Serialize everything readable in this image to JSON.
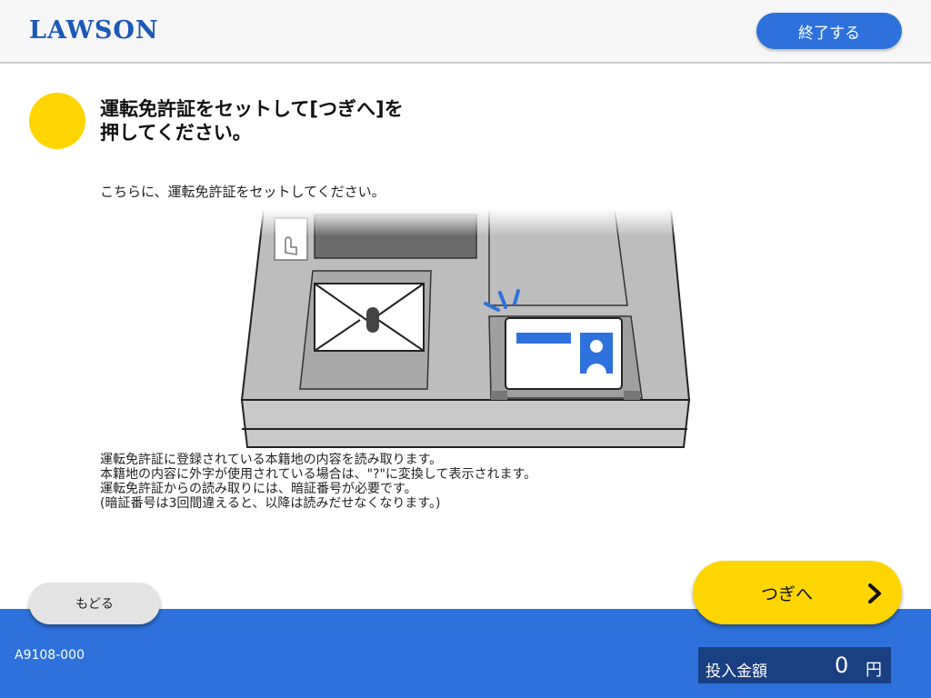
{
  "header": {
    "logo": "LAWSON",
    "end_label": "終了する"
  },
  "step": {
    "title_line1": "運転免許証をセットして[つぎへ]を",
    "title_line2": "押してください。"
  },
  "instruction": "こちらに、運転免許証をセットしてください。",
  "notes": [
    "運転免許証に登録されている本籍地の内容を読み取ります。",
    "本籍地の内容に外字が使用されている場合は、\"?\"に変換して表示されます。",
    "運転免許証からの読み取りには、暗証番号が必要です。",
    "(暗証番号は3回間違えると、以降は読みだせなくなります。)"
  ],
  "buttons": {
    "back_label": "もどる",
    "next_label": "つぎへ"
  },
  "footer": {
    "screen_code": "A9108-000",
    "amount_label": "投入金額",
    "amount_value": "0",
    "amount_unit": "円"
  },
  "colors": {
    "brand_blue": "#2d72dc",
    "accent_yellow": "#ffd500",
    "amount_box": "#1a3f82"
  },
  "icons": {
    "step_marker": "yellow-circle-icon",
    "next": "chevron-right-icon"
  }
}
